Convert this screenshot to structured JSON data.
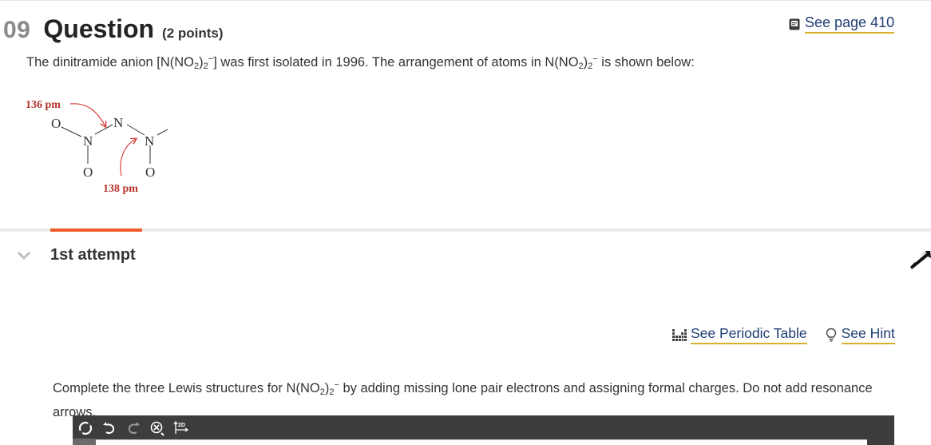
{
  "question": {
    "number": "09",
    "title": "Question",
    "points": "(2 points)"
  },
  "see_page": {
    "label": "See page 410",
    "icon": "book-icon"
  },
  "intro": {
    "part1": "The dinitramide anion [N(NO",
    "sub1": "2",
    "part2": ")",
    "sub2": "2",
    "sup1": "−",
    "part3": "] was first isolated in 1996. The arrangement of atoms in N(NO",
    "sub3": "2",
    "part4": ")",
    "sub4": "2",
    "sup2": "−",
    "part5": " is shown below:"
  },
  "molecule": {
    "label_top": "136 pm",
    "label_bottom": "138 pm",
    "atom_o": "O",
    "atom_n": "N",
    "arrow_color": "#d9403a",
    "label_color": "#b5332b"
  },
  "attempt": {
    "label": "1st attempt",
    "accent": "#f05a28"
  },
  "tools": {
    "periodic_table": "See Periodic Table",
    "hint": "See Hint"
  },
  "instructions": {
    "part1": "Complete the three Lewis structures for N(NO",
    "sub1": "2",
    "part2": ")",
    "sub2": "2",
    "sup1": "−",
    "part3": " by adding missing lone pair electrons and assigning formal charges. Do not add resonance arrows."
  },
  "editor": {
    "buttons": [
      "select-lasso-icon",
      "undo-icon",
      "redo-icon",
      "zoom-reset-icon",
      "2d-clean-icon"
    ],
    "label_2d": "2D"
  },
  "colors": {
    "link": "#1f3e73",
    "link_underline": "#d7b12b",
    "toolbar": "#3d3d3d"
  }
}
